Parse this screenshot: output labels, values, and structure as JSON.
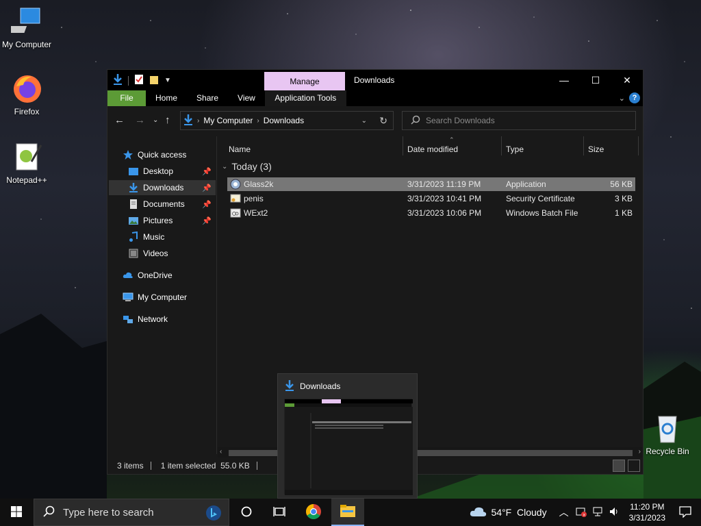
{
  "desktop": {
    "icons": [
      {
        "label": "My Computer"
      },
      {
        "label": "Firefox"
      },
      {
        "label": "Notepad++"
      },
      {
        "label": "Recycle Bin"
      }
    ]
  },
  "window": {
    "title": "Downloads",
    "context_tab": "Manage",
    "ribbon_tabs": [
      "File",
      "Home",
      "Share",
      "View",
      "Application Tools"
    ],
    "breadcrumb": [
      "My Computer",
      "Downloads"
    ],
    "search_placeholder": "Search Downloads",
    "nav": {
      "quick_access": "Quick access",
      "items": [
        "Desktop",
        "Downloads",
        "Documents",
        "Pictures",
        "Music",
        "Videos"
      ],
      "onedrive": "OneDrive",
      "my_computer": "My Computer",
      "network": "Network"
    },
    "columns": [
      "Name",
      "Date modified",
      "Type",
      "Size"
    ],
    "group_label": "Today (3)",
    "files": [
      {
        "name": "Glass2k",
        "date": "3/31/2023 11:19 PM",
        "type": "Application",
        "size": "56 KB"
      },
      {
        "name": "penis",
        "date": "3/31/2023 10:41 PM",
        "type": "Security Certificate",
        "size": "3 KB"
      },
      {
        "name": "WExt2",
        "date": "3/31/2023 10:06 PM",
        "type": "Windows Batch File",
        "size": "1 KB"
      }
    ],
    "status": {
      "items": "3 items",
      "selected": "1 item selected  55.0 KB"
    }
  },
  "preview": {
    "title": "Downloads"
  },
  "taskbar": {
    "search_placeholder": "Type here to search",
    "weather": "54°F  Cloudy",
    "time": "11:20 PM",
    "date": "3/31/2023"
  },
  "colors": {
    "manage_tab": "#e8c6f2",
    "file_tab": "#5c9b36",
    "selection": "#777777",
    "accent_blue": "#2a7fd0"
  }
}
